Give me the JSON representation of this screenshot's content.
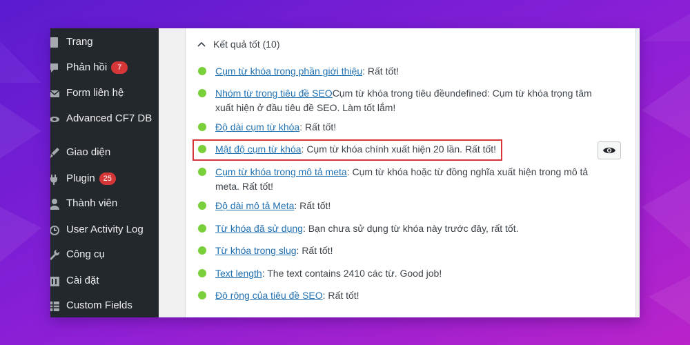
{
  "colors": {
    "background": "#6a1cc4",
    "sidebar": "#23282d",
    "link": "#2271b1",
    "good_dot": "#7ad03a",
    "badge": "#d63638",
    "highlight_border": "#d63638"
  },
  "sidebar": {
    "items": [
      {
        "label": "Trang",
        "icon": "page-icon"
      },
      {
        "label": "Phản hồi",
        "icon": "comment-icon",
        "badge": "7"
      },
      {
        "label": "Form liên hệ",
        "icon": "mail-icon"
      },
      {
        "label": "Advanced CF7 DB",
        "icon": "database-icon"
      },
      {
        "label": "Giao diện",
        "icon": "brush-icon"
      },
      {
        "label": "Plugin",
        "icon": "plugin-icon",
        "badge": "25"
      },
      {
        "label": "Thành viên",
        "icon": "user-icon"
      },
      {
        "label": "User Activity Log",
        "icon": "activity-icon"
      },
      {
        "label": "Công cụ",
        "icon": "wrench-icon"
      },
      {
        "label": "Cài đặt",
        "icon": "settings-icon"
      },
      {
        "label": "Custom Fields",
        "icon": "table-icon"
      }
    ]
  },
  "seo": {
    "section_title": "Kết quả tốt (10)",
    "section_icon": "chevron-up-icon",
    "eye_icon": "eye-icon",
    "results": [
      {
        "link": "Cụm từ khóa trong phần giới thiệu",
        "text": ": Rất tốt!"
      },
      {
        "link": "Nhóm từ trong tiêu đề SEO",
        "text": "Cụm từ khóa trong tiêu đềundefined: Cụm từ khóa trọng tâm xuất hiện ở đầu tiêu đề SEO. Làm tốt lắm!"
      },
      {
        "link": "Độ dài cụm từ khóa",
        "text": ": Rất tốt!"
      },
      {
        "link": "Mật độ cụm từ khóa",
        "text": ": Cụm từ khóa chính xuất hiện 20 lần. Rất tốt!"
      },
      {
        "link": "Cụm từ khóa trong mô tả meta",
        "text": ": Cụm từ khóa hoặc từ đồng nghĩa xuất hiện trong mô tả meta. Rất tốt!"
      },
      {
        "link": "Độ dài mô tả Meta",
        "text": ": Rất tốt!"
      },
      {
        "link": "Từ khóa đã sử dụng",
        "text": ": Bạn chưa sử dụng từ khóa này trước đây, rất tốt."
      },
      {
        "link": "Từ khóa trong slug",
        "text": ": Rất tốt!"
      },
      {
        "link": "Text length",
        "text": ": The text contains 2410 các từ. Good job!"
      },
      {
        "link": "Độ rộng của tiêu đề SEO",
        "text": ": Rất tốt!"
      }
    ]
  }
}
